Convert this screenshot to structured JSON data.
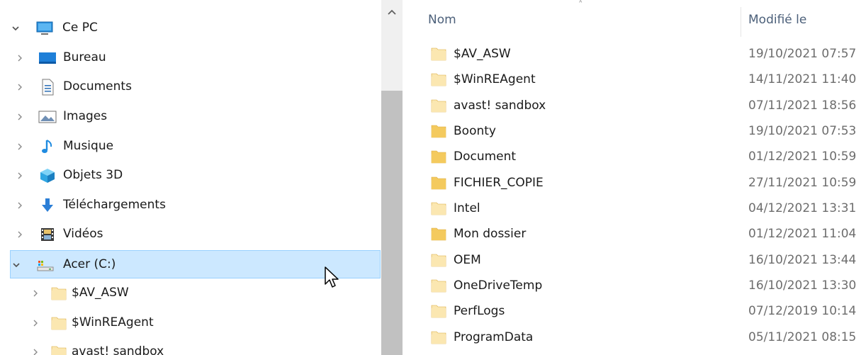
{
  "nav": {
    "items": [
      {
        "label": "Ce PC",
        "icon": "computer-icon",
        "expanded": true
      },
      {
        "label": "Bureau",
        "icon": "desktop-icon",
        "expanded": false
      },
      {
        "label": "Documents",
        "icon": "documents-icon",
        "expanded": false
      },
      {
        "label": "Images",
        "icon": "pictures-icon",
        "expanded": false
      },
      {
        "label": "Musique",
        "icon": "music-icon",
        "expanded": false
      },
      {
        "label": "Objets 3D",
        "icon": "3d-objects-icon",
        "expanded": false
      },
      {
        "label": "Téléchargements",
        "icon": "downloads-icon",
        "expanded": false
      },
      {
        "label": "Vidéos",
        "icon": "videos-icon",
        "expanded": false
      },
      {
        "label": "Acer (C:)",
        "icon": "drive-icon",
        "expanded": true,
        "selected": true
      },
      {
        "label": "$AV_ASW",
        "icon": "folder-icon",
        "expanded": false
      },
      {
        "label": "$WinREAgent",
        "icon": "folder-icon",
        "expanded": false
      },
      {
        "label": "avast! sandbox",
        "icon": "folder-icon",
        "expanded": false
      }
    ]
  },
  "content": {
    "columns": {
      "name": "Nom",
      "modified": "Modifié le"
    },
    "files": [
      {
        "name": "$AV_ASW",
        "modified": "19/10/2021 07:57",
        "faded": true
      },
      {
        "name": "$WinREAgent",
        "modified": "14/11/2021 11:40",
        "faded": true
      },
      {
        "name": "avast! sandbox",
        "modified": "07/11/2021 18:56",
        "faded": true
      },
      {
        "name": "Boonty",
        "modified": "19/10/2021 07:53",
        "faded": false
      },
      {
        "name": "Document",
        "modified": "01/12/2021 10:59",
        "faded": false
      },
      {
        "name": "FICHIER_COPIE",
        "modified": "27/11/2021 10:59",
        "faded": false
      },
      {
        "name": "Intel",
        "modified": "04/12/2021 13:31",
        "faded": true
      },
      {
        "name": "Mon dossier",
        "modified": "01/12/2021 11:04",
        "faded": false
      },
      {
        "name": "OEM",
        "modified": "16/10/2021 13:44",
        "faded": true
      },
      {
        "name": "OneDriveTemp",
        "modified": "16/10/2021 13:30",
        "faded": true
      },
      {
        "name": "PerfLogs",
        "modified": "07/12/2019 10:14",
        "faded": true
      },
      {
        "name": "ProgramData",
        "modified": "05/11/2021 08:15",
        "faded": true
      }
    ]
  },
  "colors": {
    "selection_bg": "#cce8ff",
    "selection_border": "#99d1ff",
    "header_text": "#4c607a",
    "date_text": "#6d6d6d",
    "folder": "#f4ca5e",
    "folder_faded": "#fbe7b1"
  }
}
